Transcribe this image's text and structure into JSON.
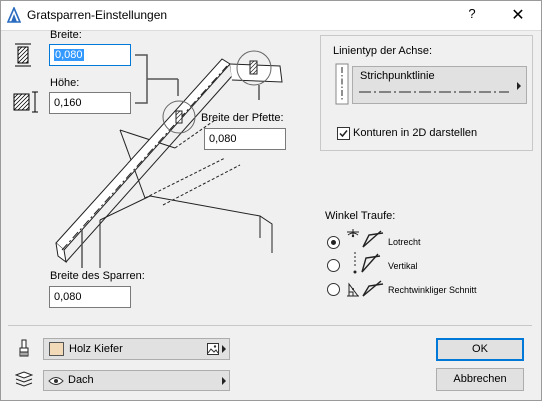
{
  "window": {
    "title": "Gratsparren-Einstellungen",
    "help_glyph": "?",
    "close_glyph": "✕"
  },
  "beam": {
    "width_label": "Breite:",
    "width_value": "0,080",
    "height_label": "Höhe:",
    "height_value": "0,160",
    "purlin_width_label": "Breite der Pfette:",
    "purlin_width_value": "0,080",
    "rafter_width_label": "Breite des Sparren:",
    "rafter_width_value": "0,080"
  },
  "axis_linetype": {
    "label": "Linientyp der Achse:",
    "value": "Strichpunktlinie",
    "contours_label": "Konturen in 2D darstellen",
    "contours_checked": true
  },
  "eaves": {
    "label": "Winkel Traufe:",
    "options": [
      {
        "label": "Lotrecht",
        "selected": true,
        "icon": "plumb-cut-icon"
      },
      {
        "label": "Vertikal",
        "selected": false,
        "icon": "vertical-cut-icon"
      },
      {
        "label": "Rechtwinkliger Schnitt",
        "selected": false,
        "icon": "square-cut-icon"
      }
    ]
  },
  "material": {
    "value": "Holz Kiefer",
    "swatch_color": "#f2d9b8"
  },
  "layer": {
    "value": "Dach"
  },
  "buttons": {
    "ok": "OK",
    "cancel": "Abbrechen"
  }
}
